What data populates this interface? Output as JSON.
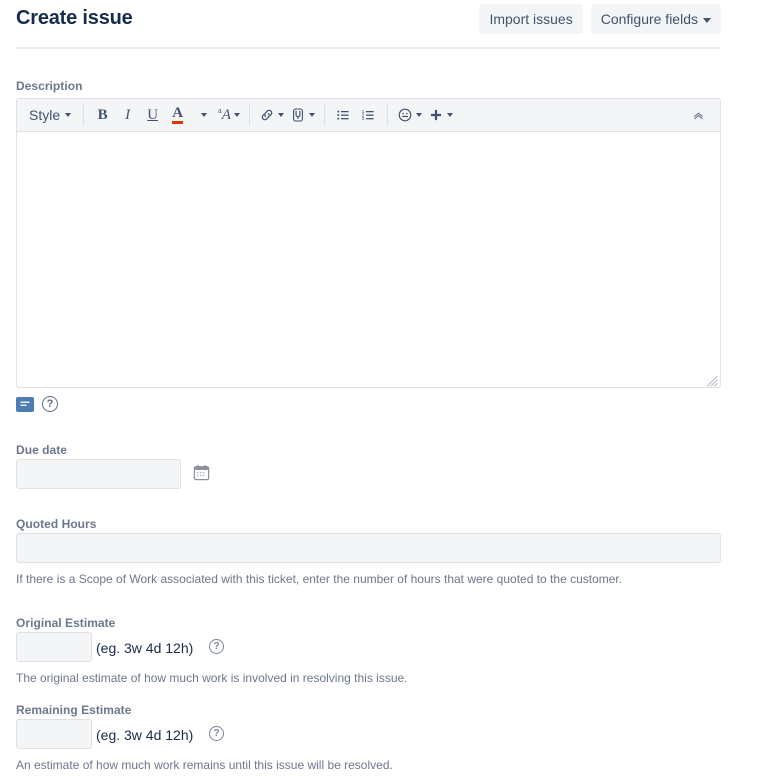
{
  "header": {
    "title": "Create issue",
    "import_button": "Import issues",
    "configure_button": "Configure fields"
  },
  "description": {
    "label": "Description",
    "value": "",
    "toolbar": {
      "style_label": "Style",
      "bold": "B",
      "italic": "I",
      "underline": "U",
      "text_color": "A",
      "text_highlight_sup": "a",
      "text_highlight": "A",
      "link": "link-icon",
      "mention": "mention-icon",
      "bullet_list": "bullet-list-icon",
      "numbered_list": "numbered-list-icon",
      "emoji": "emoji-icon",
      "insert_more": "plus-icon",
      "collapse": "double-chevron-up-icon"
    },
    "footer": {
      "markdown_toggle": "markdown-toggle-icon",
      "help": "?"
    }
  },
  "due_date": {
    "label": "Due date",
    "value": "",
    "placeholder": "",
    "calendar_icon": "calendar-icon"
  },
  "quoted_hours": {
    "label": "Quoted Hours",
    "value": "",
    "placeholder": "",
    "help": "If there is a Scope of Work associated with this ticket, enter the number of hours that were quoted to the customer."
  },
  "original_estimate": {
    "label": "Original Estimate",
    "value": "",
    "placeholder": "",
    "example": "(eg. 3w 4d 12h)",
    "help_icon": "?",
    "help": "The original estimate of how much work is involved in resolving this issue."
  },
  "remaining_estimate": {
    "label": "Remaining Estimate",
    "value": "",
    "placeholder": "",
    "example": "(eg. 3w 4d 12h)",
    "help_icon": "?",
    "help": "An estimate of how much work remains until this issue will be resolved."
  },
  "colors": {
    "accent": "#0052cc",
    "text_primary": "#172b4d",
    "text_subtle": "#6b778c",
    "field_bg": "#f4f5f7",
    "border": "#dfe1e6",
    "underline_red": "#de350b",
    "markdown_blue": "#4c7cb3"
  }
}
